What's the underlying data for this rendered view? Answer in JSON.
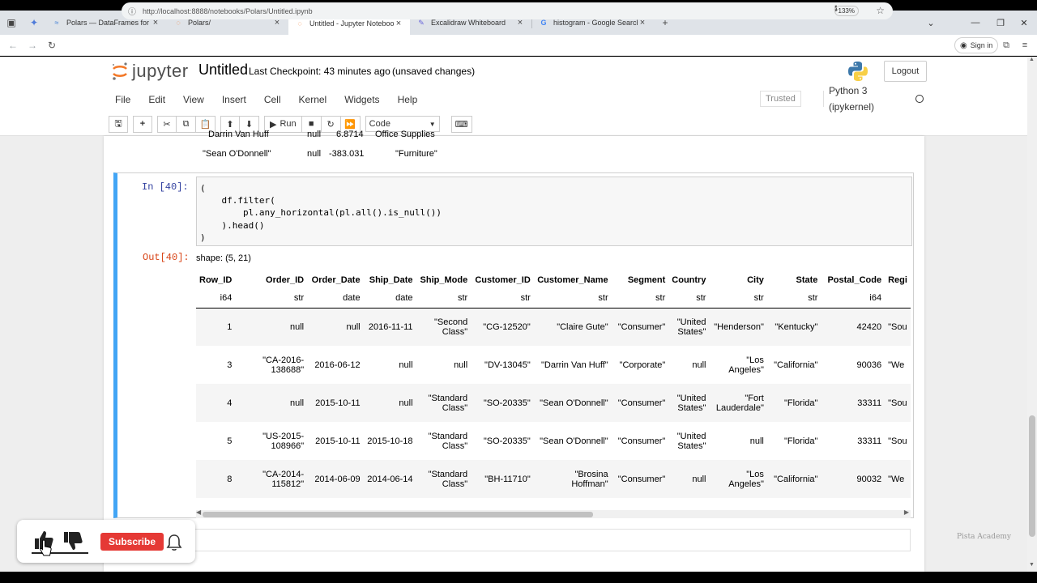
{
  "browser": {
    "tabs": [
      {
        "label": "Polars — DataFrames for the ne",
        "icon": "polars-icon"
      },
      {
        "label": "Polars/",
        "icon": "jupyter-icon"
      },
      {
        "label": "Untitled - Jupyter Notebook",
        "icon": "jupyter-icon",
        "active": true
      },
      {
        "label": "Excalidraw Whiteboard",
        "icon": "excalidraw-icon"
      },
      {
        "label": "histogram - Google Search",
        "icon": "google-icon"
      }
    ],
    "url": "http://localhost:8888/notebooks/Polars/Untitled.ipynb",
    "url_host": "localhost",
    "zoom": "133%",
    "signin": "Sign in"
  },
  "jupyter": {
    "logo_text": "jupyter",
    "title": "Untitled",
    "checkpoint": "Last Checkpoint: 43 minutes ago",
    "unsaved": "(unsaved changes)",
    "logout": "Logout",
    "menus": [
      "File",
      "Edit",
      "View",
      "Insert",
      "Cell",
      "Kernel",
      "Widgets",
      "Help"
    ],
    "trusted": "Trusted",
    "kernel": "Python 3 (ipykernel)",
    "run_label": "Run",
    "cell_type": "Code"
  },
  "previous_output": {
    "row1": [
      "Darrin Van Huff",
      "null",
      "6.8714",
      "Office Supplies"
    ],
    "row2": [
      "\"Sean O'Donnell\"",
      "null",
      "-383.031",
      "\"Furniture\""
    ]
  },
  "cell": {
    "in_prompt": "In [40]:",
    "code": "(\n    df.filter(\n        pl.any_horizontal(pl.all().is_null())\n    ).head()\n)",
    "out_prompt": "Out[40]:",
    "shape": "shape: (5, 21)"
  },
  "dataframe": {
    "columns": [
      "Row_ID",
      "Order_ID",
      "Order_Date",
      "Ship_Date",
      "Ship_Mode",
      "Customer_ID",
      "Customer_Name",
      "Segment",
      "Country",
      "City",
      "State",
      "Postal_Code",
      "Regi"
    ],
    "dtypes": [
      "i64",
      "str",
      "date",
      "date",
      "str",
      "str",
      "str",
      "str",
      "str",
      "str",
      "str",
      "i64",
      ""
    ],
    "rows": [
      [
        "1",
        "null",
        "null",
        "2016-11-11",
        "\"Second Class\"",
        "\"CG-12520\"",
        "\"Claire Gute\"",
        "\"Consumer\"",
        "\"United States\"",
        "\"Henderson\"",
        "\"Kentucky\"",
        "42420",
        "\"Sou"
      ],
      [
        "3",
        "\"CA-2016-138688\"",
        "2016-06-12",
        "null",
        "null",
        "\"DV-13045\"",
        "\"Darrin Van Huff\"",
        "\"Corporate\"",
        "null",
        "\"Los Angeles\"",
        "\"California\"",
        "90036",
        "\"We"
      ],
      [
        "4",
        "null",
        "2015-10-11",
        "null",
        "\"Standard Class\"",
        "\"SO-20335\"",
        "\"Sean O'Donnell\"",
        "\"Consumer\"",
        "\"United States\"",
        "\"Fort Lauderdale\"",
        "\"Florida\"",
        "33311",
        "\"Sou"
      ],
      [
        "5",
        "\"US-2015-108966\"",
        "2015-10-11",
        "2015-10-18",
        "\"Standard Class\"",
        "\"SO-20335\"",
        "\"Sean O'Donnell\"",
        "\"Consumer\"",
        "\"United States\"",
        "null",
        "\"Florida\"",
        "33311",
        "\"Sou"
      ],
      [
        "8",
        "\"CA-2014-115812\"",
        "2014-06-09",
        "2014-06-14",
        "\"Standard Class\"",
        "\"BH-11710\"",
        "\"Brosina Hoffman\"",
        "\"Consumer\"",
        "null",
        "\"Los Angeles\"",
        "\"California\"",
        "90032",
        "\"We"
      ]
    ]
  },
  "overlay": {
    "subscribe": "Subscribe"
  },
  "watermark": "Pista Academy",
  "colors": {
    "cell_border": "#42a5f5",
    "in_prompt": "#303f9f",
    "out_prompt": "#d84315",
    "subscribe": "#e53935"
  }
}
